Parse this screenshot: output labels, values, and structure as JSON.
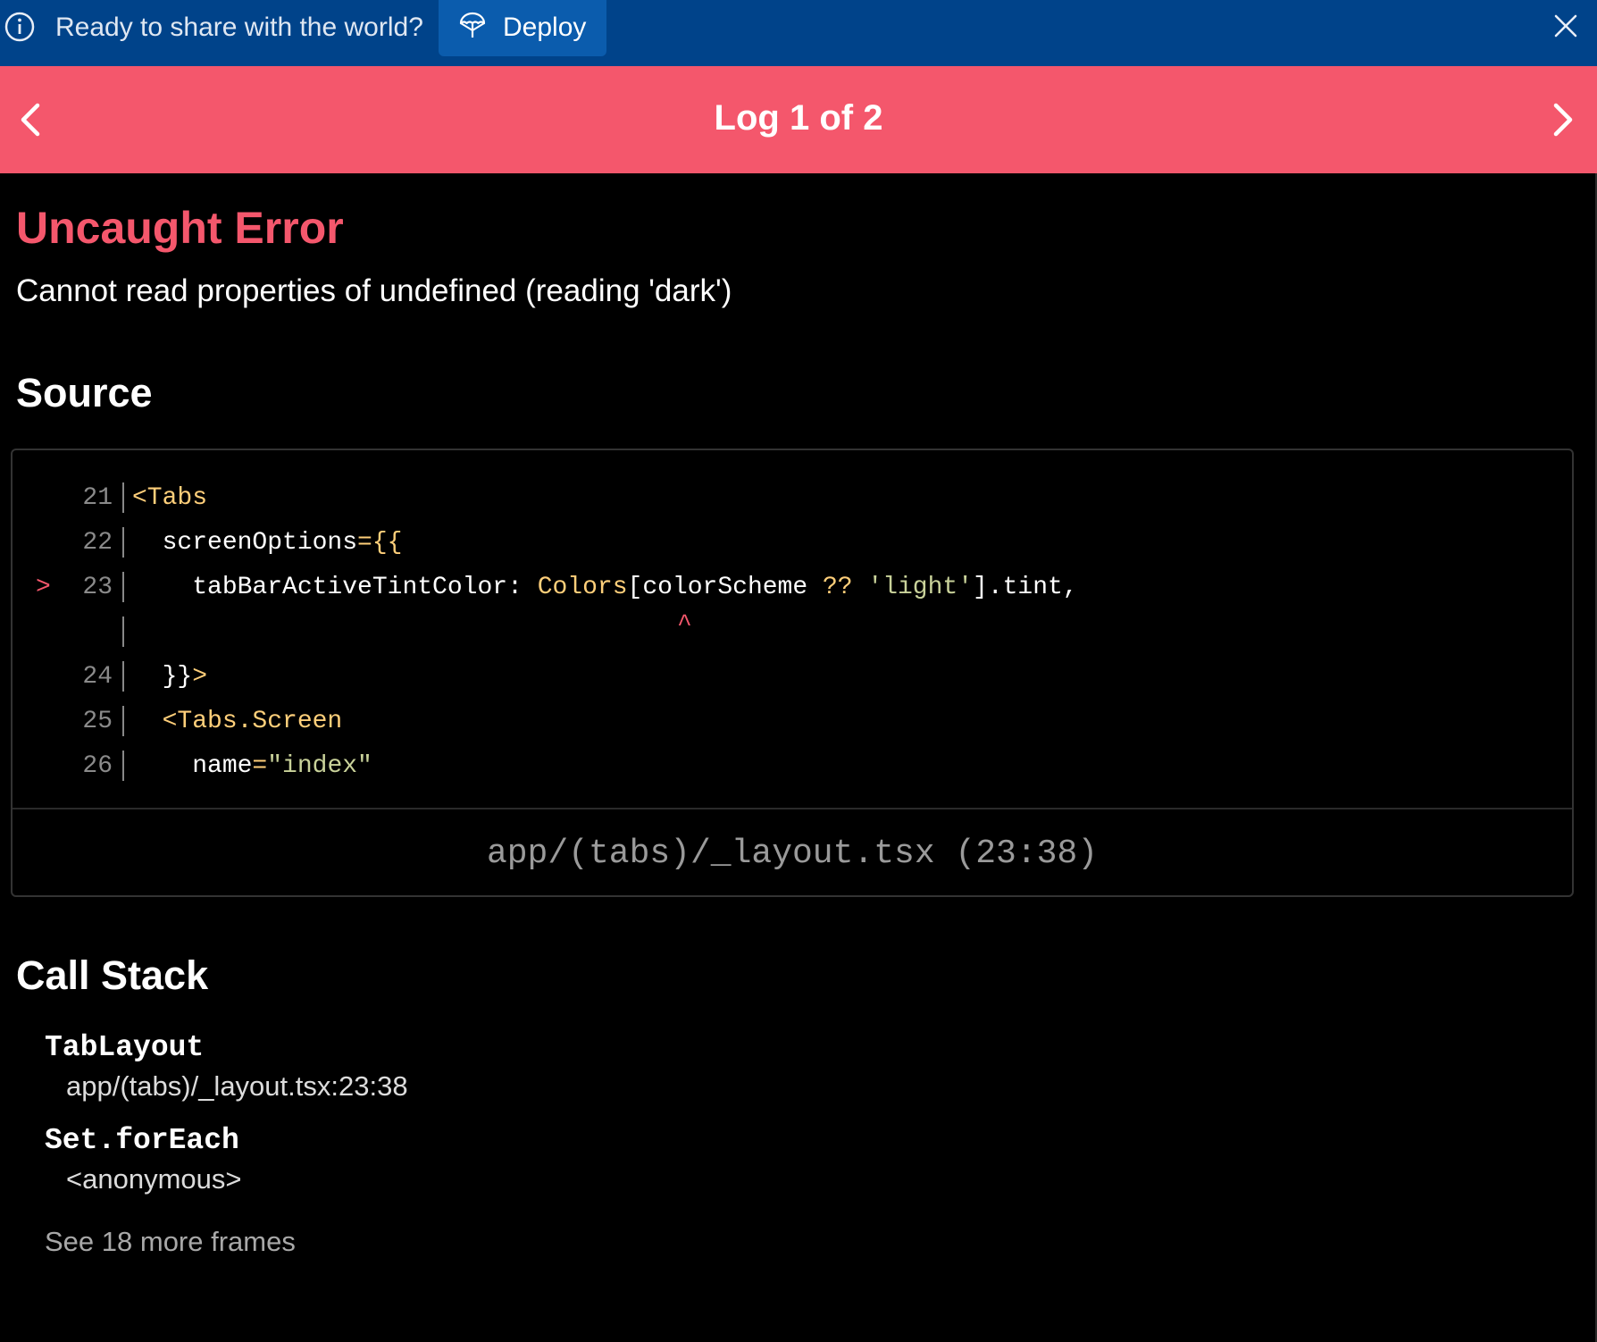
{
  "banner": {
    "message": "Ready to share with the world?",
    "deploy_label": "Deploy"
  },
  "log_nav": {
    "title": "Log 1 of 2"
  },
  "error": {
    "title": "Uncaught Error",
    "message": "Cannot read properties of undefined (reading 'dark')"
  },
  "source": {
    "heading": "Source",
    "lines": [
      {
        "marker": "",
        "lineno": "21"
      },
      {
        "marker": "",
        "lineno": "22"
      },
      {
        "marker": ">",
        "lineno": "23"
      },
      {
        "marker": "",
        "lineno": ""
      },
      {
        "marker": "",
        "lineno": "24"
      },
      {
        "marker": "",
        "lineno": "25"
      },
      {
        "marker": "",
        "lineno": "26"
      }
    ],
    "code": {
      "l21_tag": "<Tabs",
      "l22_attr": "  screenOptions",
      "l22_punct": "={{",
      "l23_key": "    tabBarActiveTintColor: ",
      "l23_colors": "Colors",
      "l23_bracket_open": "[",
      "l23_scheme": "colorScheme ",
      "l23_op": "?? ",
      "l23_str": "'light'",
      "l23_rest": "].tint,",
      "caret": "^",
      "l24": "  }}",
      "l24_gt": ">",
      "l25_tag": "  <Tabs.Screen",
      "l26_attr": "    name",
      "l26_eq": "=",
      "l26_str": "\"index\""
    },
    "file": "app/(tabs)/_layout.tsx (23:38)"
  },
  "call_stack": {
    "heading": "Call Stack",
    "frames": [
      {
        "name": "TabLayout",
        "location": "app/(tabs)/_layout.tsx:23:38"
      },
      {
        "name": "Set.forEach",
        "location": "<anonymous>"
      }
    ],
    "more_label": "See 18 more frames"
  },
  "colors": {
    "banner_bg": "#00438a",
    "deploy_bg": "#0b5cad",
    "lognav_bg": "#f4576c",
    "error_accent": "#f4576c",
    "code_tag": "#ffcf7a",
    "code_string": "#c9d29a"
  },
  "icons": {
    "banner_info": "info-circle-icon",
    "deploy": "parachute-icon",
    "close": "close-icon",
    "prev": "chevron-left-icon",
    "next": "chevron-right-icon"
  }
}
